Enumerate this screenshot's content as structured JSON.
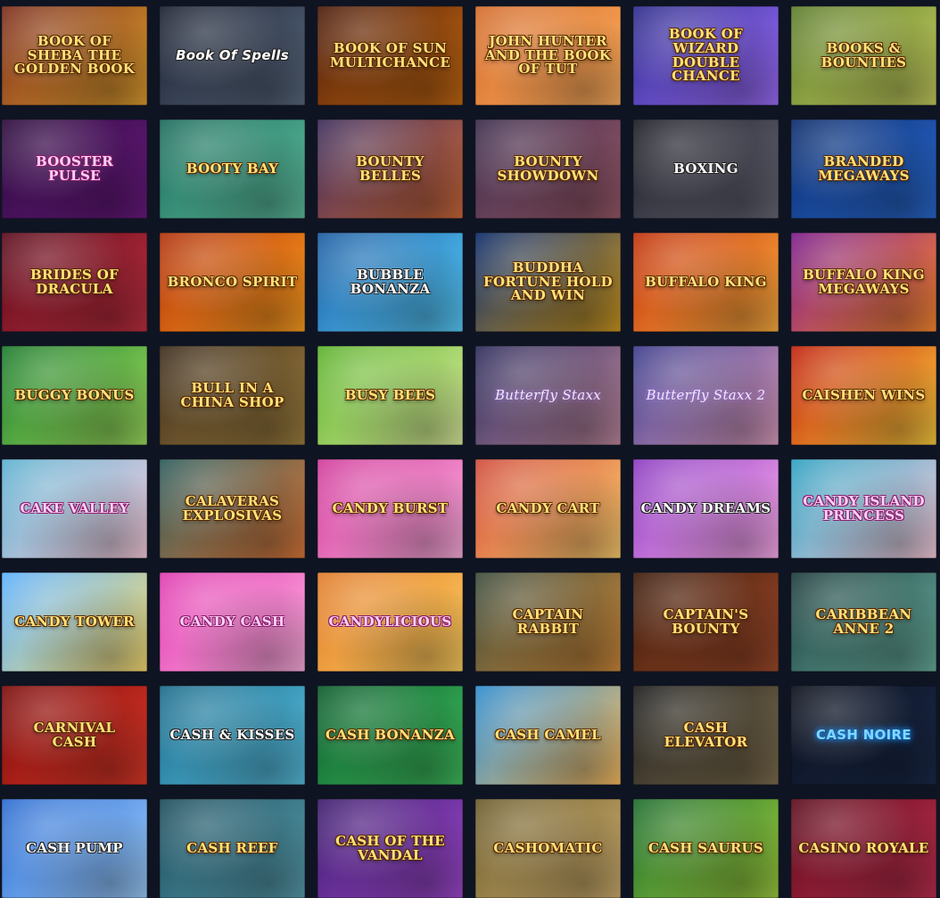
{
  "games": [
    {
      "title": "Book of Sheba The Golden Book",
      "name": "book-of-sheba",
      "bg": [
        "#7a2b1a",
        "#e0a030"
      ],
      "style": ""
    },
    {
      "title": "Book Of Spells",
      "name": "book-of-spells",
      "bg": [
        "#1a2030",
        "#5b6a80"
      ],
      "style": "white script"
    },
    {
      "title": "Book of Sun Multichance",
      "name": "book-of-sun",
      "bg": [
        "#4a1a0a",
        "#c66a12"
      ],
      "style": ""
    },
    {
      "title": "John Hunter and the Book of Tut",
      "name": "book-of-tut",
      "bg": [
        "#d26a2a",
        "#ffb060"
      ],
      "style": ""
    },
    {
      "title": "Book of Wizard Double Chance",
      "name": "book-of-wizard",
      "bg": [
        "#2b2a8a",
        "#a070ff"
      ],
      "style": ""
    },
    {
      "title": "Books & Bounties",
      "name": "books-and-bounties",
      "bg": [
        "#5a7a2a",
        "#c8d060"
      ],
      "style": ""
    },
    {
      "title": "Booster Pulse",
      "name": "booster",
      "bg": [
        "#2a0a3a",
        "#6a1a80"
      ],
      "style": "pink"
    },
    {
      "title": "Booty Bay",
      "name": "booty-bay",
      "bg": [
        "#1a6a5a",
        "#60c0a0"
      ],
      "style": ""
    },
    {
      "title": "Bounty Belles",
      "name": "bounty-belles",
      "bg": [
        "#3a2a5a",
        "#d06a3a"
      ],
      "style": ""
    },
    {
      "title": "Bounty Showdown",
      "name": "bounty-showdown",
      "bg": [
        "#3a2a4a",
        "#9a5a6a"
      ],
      "style": ""
    },
    {
      "title": "Boxing",
      "name": "boxing",
      "bg": [
        "#1a1a22",
        "#6a6a7a"
      ],
      "style": "white"
    },
    {
      "title": "Branded Megaways",
      "name": "branded-megaways",
      "bg": [
        "#0a2a6a",
        "#2a6ad0"
      ],
      "style": ""
    },
    {
      "title": "Brides of Dracula",
      "name": "brides-of-dracula",
      "bg": [
        "#5a0a1a",
        "#c03040"
      ],
      "style": ""
    },
    {
      "title": "Bronco Spirit",
      "name": "bronco-spirit",
      "bg": [
        "#b0300a",
        "#ffa020"
      ],
      "style": ""
    },
    {
      "title": "Bubble Bonanza",
      "name": "bubble-bonanza",
      "bg": [
        "#1a5aa0",
        "#5ad0ff"
      ],
      "style": "white"
    },
    {
      "title": "Buddha Fortune Hold and Win",
      "name": "buddha-fortune",
      "bg": [
        "#0a2a6a",
        "#d09a20"
      ],
      "style": ""
    },
    {
      "title": "Buffalo King",
      "name": "buffalo-king",
      "bg": [
        "#c0300a",
        "#ffb040"
      ],
      "style": ""
    },
    {
      "title": "Buffalo King Megaways",
      "name": "buffalo-king-megaways",
      "bg": [
        "#7a1a8a",
        "#ff8a30"
      ],
      "style": ""
    },
    {
      "title": "Buggy Bonus",
      "name": "buggy-bonus",
      "bg": [
        "#1a7a2a",
        "#a0e060"
      ],
      "style": ""
    },
    {
      "title": "Bull in a China Shop",
      "name": "bull-china-shop",
      "bg": [
        "#3a2a1a",
        "#a08040"
      ],
      "style": ""
    },
    {
      "title": "Busy Bees",
      "name": "busy-bees",
      "bg": [
        "#5ab02a",
        "#e0f0a0"
      ],
      "style": ""
    },
    {
      "title": "Butterfly Staxx",
      "name": "butterfly-staxx",
      "bg": [
        "#2a2a5a",
        "#c08aa0"
      ],
      "style": "lilac"
    },
    {
      "title": "Butterfly Staxx 2",
      "name": "butterfly-staxx-2",
      "bg": [
        "#3a3a8a",
        "#e0a0c0"
      ],
      "style": "lilac"
    },
    {
      "title": "Caishen Wins",
      "name": "caishen-wins",
      "bg": [
        "#c0200a",
        "#ffd040"
      ],
      "style": ""
    },
    {
      "title": "Cake Valley",
      "name": "cake-valley",
      "bg": [
        "#5ab0d0",
        "#ffd0e0"
      ],
      "style": "pink"
    },
    {
      "title": "Calaveras Explosivas",
      "name": "calaveras-explosivas",
      "bg": [
        "#2a5a5a",
        "#e07a3a"
      ],
      "style": ""
    },
    {
      "title": "Candy Burst",
      "name": "candy-burst",
      "bg": [
        "#d03a9a",
        "#ffb0e0"
      ],
      "style": ""
    },
    {
      "title": "Candy Cart",
      "name": "candy-cart",
      "bg": [
        "#d04a3a",
        "#ffd070"
      ],
      "style": ""
    },
    {
      "title": "Candy Dreams",
      "name": "candy-dreams",
      "bg": [
        "#8a3ac0",
        "#ffb0f0"
      ],
      "style": "white"
    },
    {
      "title": "Candy Island Princess",
      "name": "candy-island-princess",
      "bg": [
        "#2aa0c0",
        "#ffd0e0"
      ],
      "style": "pink"
    },
    {
      "title": "Candy Tower",
      "name": "candy-tower",
      "bg": [
        "#5ab0ff",
        "#ffe070"
      ],
      "style": ""
    },
    {
      "title": "Candy Cash",
      "name": "candy-cash",
      "bg": [
        "#e03ab0",
        "#ffb0e0"
      ],
      "style": "pink"
    },
    {
      "title": "Candylicious",
      "name": "candylicious",
      "bg": [
        "#e07a2a",
        "#ffd060"
      ],
      "style": "pink"
    },
    {
      "title": "Captain Rabbit",
      "name": "captain-rabbit",
      "bg": [
        "#3a4a3a",
        "#d08a3a"
      ],
      "style": ""
    },
    {
      "title": "Captain's Bounty",
      "name": "captains-bounty",
      "bg": [
        "#3a1a0a",
        "#a04a2a"
      ],
      "style": ""
    },
    {
      "title": "Caribbean Anne 2",
      "name": "caribbean-anne-2",
      "bg": [
        "#1a3a3a",
        "#6ab0a0"
      ],
      "style": ""
    },
    {
      "title": "Carnival Cash",
      "name": "carnival-cash",
      "bg": [
        "#7a0a0a",
        "#e03a2a"
      ],
      "style": ""
    },
    {
      "title": "Cash & Kisses",
      "name": "cash-and-kisses",
      "bg": [
        "#1a6a8a",
        "#5ac0e0"
      ],
      "style": "white"
    },
    {
      "title": "Cash Bonanza",
      "name": "cash-bonanza",
      "bg": [
        "#0a5a2a",
        "#40c060"
      ],
      "style": ""
    },
    {
      "title": "Cash Camel",
      "name": "cash-camel",
      "bg": [
        "#2a8ad0",
        "#ffc060"
      ],
      "style": ""
    },
    {
      "title": "Cash Elevator",
      "name": "cash-elevator",
      "bg": [
        "#1a1a1a",
        "#807050"
      ],
      "style": ""
    },
    {
      "title": "Cash Noire",
      "name": "cash-noire",
      "bg": [
        "#0a0e1a",
        "#1a2a4a"
      ],
      "style": "neon"
    },
    {
      "title": "Cash Pump",
      "name": "cash-pump",
      "bg": [
        "#2a6ad0",
        "#a0d0ff"
      ],
      "style": "white"
    },
    {
      "title": "Cash Reef",
      "name": "cash-reef",
      "bg": [
        "#1a4a5a",
        "#5aa0b0"
      ],
      "style": ""
    },
    {
      "title": "Cash of the Vandal",
      "name": "cash-of-the-vandal",
      "bg": [
        "#3a1a6a",
        "#a04ad0"
      ],
      "style": ""
    },
    {
      "title": "Cashomatic",
      "name": "cashomatic",
      "bg": [
        "#6a5a2a",
        "#d0b070"
      ],
      "style": ""
    },
    {
      "title": "Cash Saurus",
      "name": "cash-saurus",
      "bg": [
        "#1a6a2a",
        "#a0d040"
      ],
      "style": ""
    },
    {
      "title": "Casino Royale",
      "name": "casino-royale",
      "bg": [
        "#5a0a1a",
        "#c03050"
      ],
      "style": ""
    }
  ]
}
